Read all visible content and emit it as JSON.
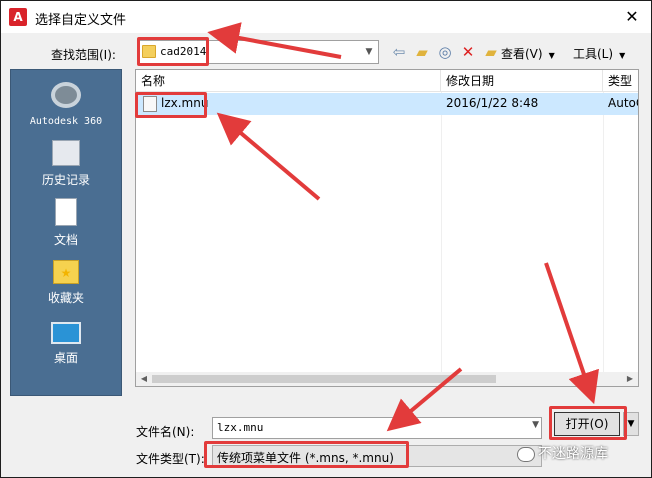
{
  "window": {
    "title": "选择自定义文件",
    "close_glyph": "✕",
    "app_icon_letter": "A"
  },
  "lookin": {
    "label": "查找范围(I):",
    "value": "cad2014"
  },
  "toolbar": {
    "icons": [
      "back-icon",
      "up-folder-icon",
      "search-web-icon",
      "delete-icon",
      "new-folder-icon"
    ],
    "view_label": "查看(V)",
    "tools_label": "工具(L)"
  },
  "places": [
    {
      "label": "Autodesk 360",
      "icon": "autodesk-360-icon"
    },
    {
      "label": "历史记录",
      "icon": "history-icon"
    },
    {
      "label": "文档",
      "icon": "documents-icon"
    },
    {
      "label": "收藏夹",
      "icon": "favorites-icon"
    },
    {
      "label": "桌面",
      "icon": "desktop-icon"
    }
  ],
  "filelist": {
    "columns": {
      "name": "名称",
      "date": "修改日期",
      "type": "类型"
    },
    "rows": [
      {
        "name": "lzx.mnu",
        "date": "2016/1/22 8:48",
        "type": "AutoC"
      }
    ]
  },
  "bottom": {
    "filename_label": "文件名(N):",
    "filename_value": "lzx.mnu",
    "filetype_label": "文件类型(T):",
    "filetype_value": "传统项菜单文件 (*.mns, *.mnu)",
    "open_label": "打开(O)"
  },
  "watermark": {
    "text": "不迷路源库"
  },
  "colors": {
    "highlight": "#e23b3b",
    "selection": "#cce8ff",
    "places_bg": "#4a6e92"
  }
}
